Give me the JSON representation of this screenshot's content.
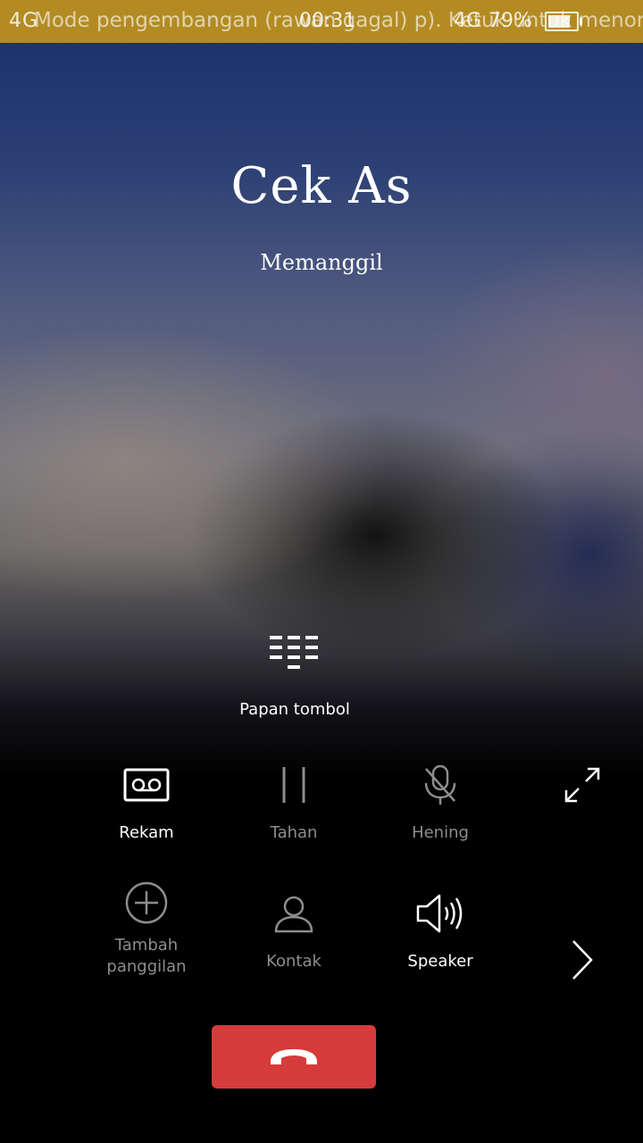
{
  "status_bar": {
    "left_text": "4G",
    "notice": "Mode pengembangan (rawan gagal) p). Ketuk untuk menonaktifkan",
    "time": "00:31",
    "network": "4G",
    "battery_percent": "79%"
  },
  "call": {
    "caller_name": "Cek As",
    "status": "Memanggil"
  },
  "keypad": {
    "label": "Papan tombol",
    "icon": "keypad-icon"
  },
  "controls": [
    {
      "label": "Rekam",
      "icon": "record-icon",
      "enabled": true
    },
    {
      "label": "Tahan",
      "icon": "pause-icon",
      "enabled": false
    },
    {
      "label": "Hening",
      "icon": "mute-mic-icon",
      "enabled": false
    },
    {
      "label": "Tambah\npanggilan",
      "icon": "add-call-icon",
      "enabled": false
    },
    {
      "label": "Kontak",
      "icon": "contact-icon",
      "enabled": false
    },
    {
      "label": "Speaker",
      "icon": "speaker-icon",
      "enabled": true
    }
  ],
  "colors": {
    "status_bar": "#b38b22",
    "end_call": "#d63b3b",
    "dim_label": "#8d8d8d"
  }
}
